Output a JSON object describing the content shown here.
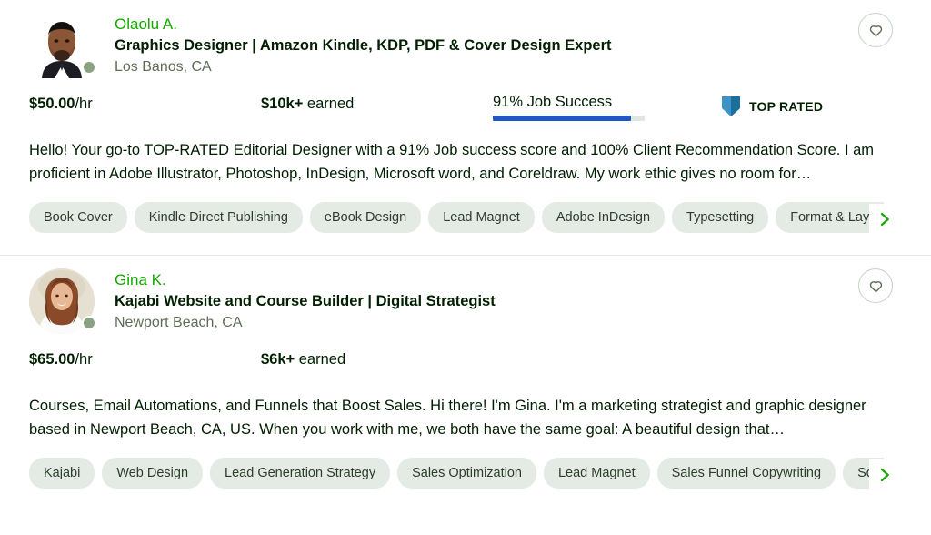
{
  "colors": {
    "brand_green": "#14a800",
    "text_primary": "#001e00",
    "text_muted": "#5e6d55",
    "tag_bg": "#e4ebe4",
    "jss_bar": "#1f57c3",
    "jss_track": "#dfe5df",
    "badge_blue_light": "#3f93c4",
    "badge_blue_dark": "#1b6f9c",
    "status_dot": "#8aa184",
    "divider": "#e4ebe4"
  },
  "cards": [
    {
      "name": "Olaolu A.",
      "title": "Graphics Designer | Amazon Kindle, KDP, PDF & Cover Design Expert",
      "location": "Los Banos, CA",
      "avatar_shape": "square",
      "rate_amount": "$50.00",
      "rate_unit": "/hr",
      "earned_amount": "$10k+",
      "earned_label": " earned",
      "job_success_label": "91% Job Success",
      "job_success_percent": 91,
      "badge_label": "TOP RATED",
      "badge_icon": "shield-icon",
      "favorite_icon": "heart-icon",
      "status_icon": "online-status-dot",
      "description": "Hello! Your go-to TOP-RATED Editorial Designer with a 91% Job success score and 100% Client Recommendation Score. I am proficient in Adobe Illustrator, Photoshop, InDesign, Microsoft word, and Coreldraw. My work ethic gives no room for…",
      "skills": [
        "Book Cover",
        "Kindle Direct Publishing",
        "eBook Design",
        "Lead Magnet",
        "Adobe InDesign",
        "Typesetting",
        "Format & Layout"
      ],
      "next_icon": "chevron-right-icon"
    },
    {
      "name": "Gina K.",
      "title": "Kajabi Website and Course Builder | Digital Strategist",
      "location": "Newport Beach, CA",
      "avatar_shape": "circle",
      "rate_amount": "$65.00",
      "rate_unit": "/hr",
      "earned_amount": "$6k+",
      "earned_label": " earned",
      "job_success_label": "",
      "job_success_percent": 0,
      "badge_label": "",
      "badge_icon": "",
      "favorite_icon": "heart-icon",
      "status_icon": "online-status-dot",
      "description": "Courses, Email Automations, and Funnels that Boost Sales. Hi there! I'm Gina. I'm a marketing strategist and graphic designer based in Newport Beach, CA, US. When you work with me, we both have the same goal: A beautiful design that…",
      "skills": [
        "Kajabi",
        "Web Design",
        "Lead Generation Strategy",
        "Sales Optimization",
        "Lead Magnet",
        "Sales Funnel Copywriting",
        "Squarespace"
      ],
      "next_icon": "chevron-right-icon"
    }
  ]
}
